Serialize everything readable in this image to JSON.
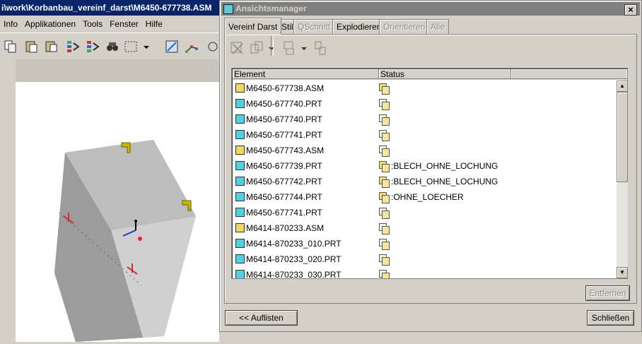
{
  "app": {
    "title": "i\\work\\Korbanbau_vereinf_darst\\M6450-677738.ASM",
    "menu": [
      "Info",
      "Applikationen",
      "Tools",
      "Fenster",
      "Hilfe"
    ]
  },
  "dialog": {
    "title": "Ansichtsmanager",
    "close_label": "×",
    "tabs": [
      {
        "label": "Vereinf Darst",
        "active": true,
        "disabled": false
      },
      {
        "label": "Stil",
        "active": false,
        "disabled": false
      },
      {
        "label": "QSchnitt",
        "active": false,
        "disabled": true
      },
      {
        "label": "Explodieren",
        "active": false,
        "disabled": false
      },
      {
        "label": "Orientieren",
        "active": false,
        "disabled": true
      },
      {
        "label": "Alle",
        "active": false,
        "disabled": true
      }
    ],
    "columns": {
      "element": "Element",
      "status": "Status"
    },
    "rows": [
      {
        "element": "M6450-677738.ASM",
        "type": "asm",
        "status": "",
        "status_icon": "doc-icon"
      },
      {
        "element": "M6450-677740.PRT",
        "type": "prt",
        "status": "",
        "status_icon": "master-rep-icon"
      },
      {
        "element": "M6450-677740.PRT",
        "type": "prt",
        "status": "",
        "status_icon": "master-rep-icon"
      },
      {
        "element": "M6450-677741.PRT",
        "type": "prt",
        "status": "",
        "status_icon": "master-rep-icon"
      },
      {
        "element": "M6450-677743.ASM",
        "type": "asm",
        "status": "",
        "status_icon": "master-rep-icon"
      },
      {
        "element": "M6450-677739.PRT",
        "type": "prt",
        "status": ":BLECH_OHNE_LOCHUNG",
        "status_icon": "simplified-rep-icon"
      },
      {
        "element": "M6450-677742.PRT",
        "type": "prt",
        "status": ":BLECH_OHNE_LOCHUNG",
        "status_icon": "simplified-rep-icon"
      },
      {
        "element": "M6450-677744.PRT",
        "type": "prt",
        "status": ":OHNE_LOECHER",
        "status_icon": "simplified-rep-icon"
      },
      {
        "element": "M6450-677741.PRT",
        "type": "prt",
        "status": "",
        "status_icon": "master-rep-icon"
      },
      {
        "element": "M6414-870233.ASM",
        "type": "asm",
        "status": "",
        "status_icon": "master-rep-icon"
      },
      {
        "element": "M6414-870233_010.PRT",
        "type": "prt",
        "status": "",
        "status_icon": "master-rep-icon"
      },
      {
        "element": "M6414-870233_020.PRT",
        "type": "prt",
        "status": "",
        "status_icon": "master-rep-icon"
      },
      {
        "element": "M6414-870233_030.PRT",
        "type": "prt",
        "status": "",
        "status_icon": "master-rep-icon"
      }
    ],
    "remove_label": "Entfernen",
    "list_back_label": "<< Auflisten",
    "close_button_label": "Schließen"
  },
  "colors": {
    "app_title_bg": "#0a246a",
    "dialog_title_bg": "#808080",
    "window_bg": "#d4d0c8",
    "prt_icon": "#4fd0e6",
    "asm_icon": "#f0d860"
  }
}
